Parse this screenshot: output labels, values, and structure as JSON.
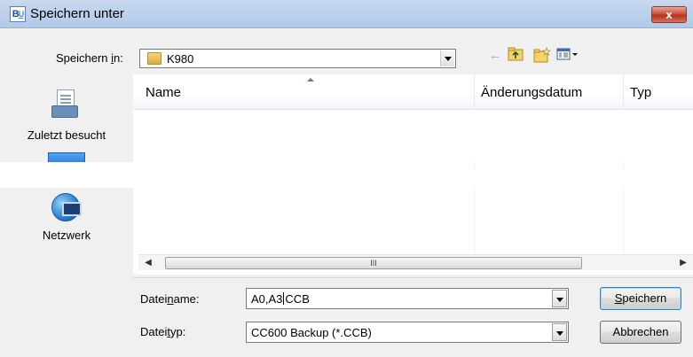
{
  "window": {
    "title": "Speichern unter",
    "close_label": "x",
    "app_icon_text_b": "B",
    "app_icon_text_u": "U"
  },
  "location": {
    "label_prefix": "Speichern ",
    "label_underlined": "i",
    "label_suffix": "n:",
    "current_folder": "K980",
    "toolbar": {
      "back_icon": "back-arrow-icon",
      "up_icon": "up-folder-icon",
      "new_folder_icon": "new-folder-icon",
      "views_icon": "views-menu-icon"
    }
  },
  "sidebar": {
    "items": [
      {
        "label": "Zuletzt besucht",
        "icon": "recent-places-icon"
      },
      {
        "label": "",
        "icon": "desktop-icon"
      },
      {
        "label": "Netzwerk",
        "icon": "network-icon"
      }
    ]
  },
  "filelist": {
    "columns": [
      "Name",
      "Änderungsdatum",
      "Typ"
    ],
    "rows": []
  },
  "scrollbar": {
    "thumb_grip": "III"
  },
  "filename": {
    "label_prefix": "Datei",
    "label_underlined": "n",
    "label_suffix": "ame:",
    "value_before_caret": "A0,A3",
    "value_after_caret": "CCB"
  },
  "filetype": {
    "label_prefix": "Datei",
    "label_underlined": "t",
    "label_suffix": "yp:",
    "value": "CC600 Backup (*.CCB)"
  },
  "buttons": {
    "save_underlined": "S",
    "save_rest": "peichern",
    "cancel": "Abbrechen"
  }
}
